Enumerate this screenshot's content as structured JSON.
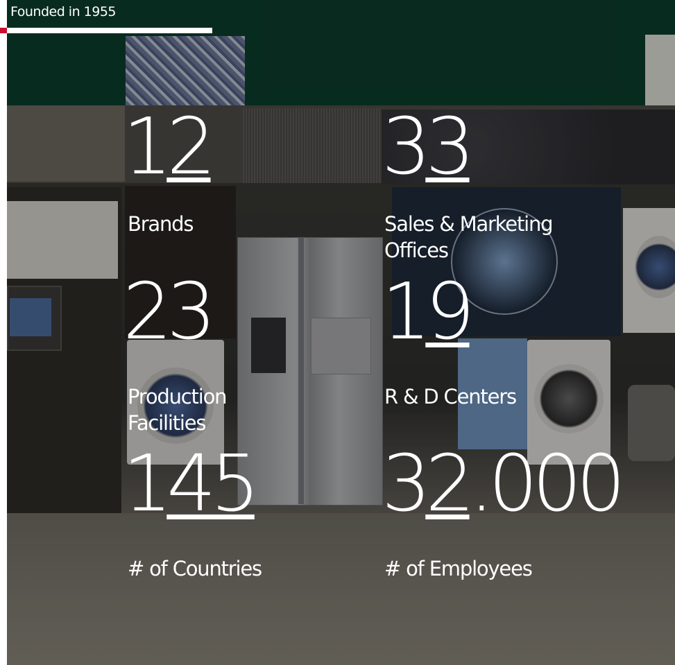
{
  "header": {
    "label": "Founded in 1955"
  },
  "colors": {
    "accent": "#c8102e",
    "text": "#ffffff"
  },
  "stats": [
    {
      "number_a": "1",
      "number_b": "2",
      "number_c": "",
      "label_line1": "Brands",
      "label_line2": ""
    },
    {
      "number_a": "3",
      "number_b": "3",
      "number_c": "",
      "label_line1": "Sales & Marketing",
      "label_line2": "Offices"
    },
    {
      "number_a": "2",
      "number_b": "3",
      "number_c": "",
      "label_line1": "Production",
      "label_line2": "Facilities"
    },
    {
      "number_a": "1",
      "number_b": "9",
      "number_c": "",
      "label_line1": "R & D Centers",
      "label_line2": ""
    },
    {
      "number_a": "1",
      "number_b": "45",
      "number_c": "",
      "label_line1": "# of Countries",
      "label_line2": ""
    },
    {
      "number_a": "3",
      "number_b": "2",
      "number_c": ".000",
      "label_line1": "# of Employees",
      "label_line2": ""
    }
  ]
}
